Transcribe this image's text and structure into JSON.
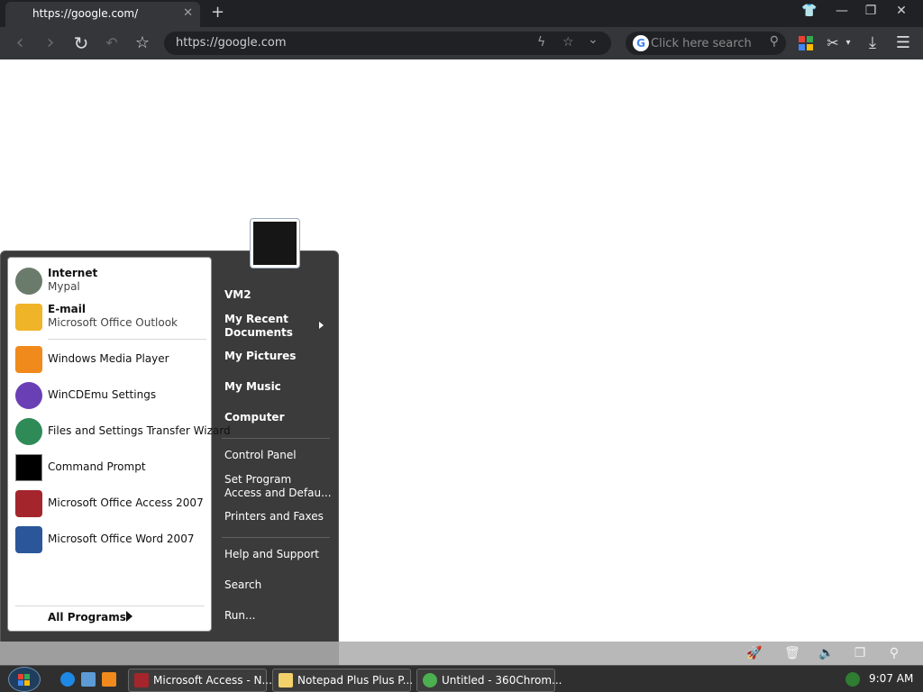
{
  "browser": {
    "tab": {
      "title": "https://google.com/",
      "close_glyph": "✕"
    },
    "new_tab_glyph": "+",
    "window_buttons": [
      {
        "name": "shirt-icon",
        "glyph": "👕"
      },
      {
        "name": "minimize-icon",
        "glyph": "—"
      },
      {
        "name": "restore-icon",
        "glyph": "❐"
      },
      {
        "name": "close-window-icon",
        "glyph": "✕"
      }
    ],
    "toolbar": {
      "back_glyph": "‹",
      "forward_glyph": "›",
      "reload_glyph": "↻",
      "undo_glyph": "↶",
      "star_glyph": "☆",
      "address_value": "https://google.com",
      "lightning_glyph": "ϟ",
      "addr_star_glyph": "☆",
      "chevron_glyph": "⌄",
      "search_placeholder": "Click here search",
      "search_g": "G",
      "search_mag_glyph": "⚲",
      "cut_glyph": "✂",
      "cut_dropdown_glyph": "▾",
      "download_glyph": "⤓",
      "menu_glyph": "☰",
      "apps_colors": [
        "#e94235",
        "#34a853",
        "#4285f4",
        "#fbbc04"
      ]
    }
  },
  "start_menu": {
    "pinned": [
      {
        "name": "Internet",
        "sub": "Mypal",
        "icon": "raccoon-icon",
        "color": "#6b7b6b"
      },
      {
        "name": "E-mail",
        "sub": "Microsoft Office Outlook",
        "icon": "outlook-icon",
        "color": "#f0b429"
      }
    ],
    "recent": [
      {
        "name": "Windows Media Player",
        "icon": "media-player-icon",
        "color": "#f08a1c"
      },
      {
        "name": "WinCDEmu Settings",
        "icon": "wincdemu-icon",
        "color": "#6a3fb5"
      },
      {
        "name": "Files and Settings Transfer Wizard",
        "icon": "transfer-wizard-icon",
        "color": "#2e8b57"
      },
      {
        "name": "Command Prompt",
        "icon": "command-prompt-icon",
        "color": "#000000"
      },
      {
        "name": "Microsoft Office Access 2007",
        "icon": "access-icon",
        "color": "#a4262c"
      },
      {
        "name": "Microsoft Office Word 2007",
        "icon": "word-icon",
        "color": "#2b579a"
      }
    ],
    "all_programs": "All Programs",
    "right_bold": [
      "VM2",
      "My Recent\nDocuments",
      "My Pictures",
      "My Music",
      "Computer"
    ],
    "right_normal": [
      "Control Panel",
      "Set Program\nAccess and Defau...",
      "Printers and Faxes",
      "Help and Support",
      "Search",
      "Run..."
    ]
  },
  "statusbar": {
    "icons": [
      {
        "name": "rocket-icon",
        "glyph": "🚀"
      },
      {
        "name": "trash-icon",
        "glyph": "🗑"
      },
      {
        "name": "volume-icon",
        "glyph": "🔈"
      },
      {
        "name": "window-icon",
        "glyph": "❐"
      },
      {
        "name": "search-icon",
        "glyph": "⚲"
      }
    ]
  },
  "taskbar": {
    "tasks": [
      {
        "label": "Microsoft Access - N...",
        "icon": "access-icon",
        "color": "#a4262c"
      },
      {
        "label": "Notepad Plus Plus P...",
        "icon": "notepad-icon",
        "color": "#f2d16b"
      },
      {
        "label": "Untitled - 360Chrom...",
        "icon": "chrome360-icon",
        "color": "#4caf50"
      }
    ],
    "clock": "9:07 AM"
  }
}
